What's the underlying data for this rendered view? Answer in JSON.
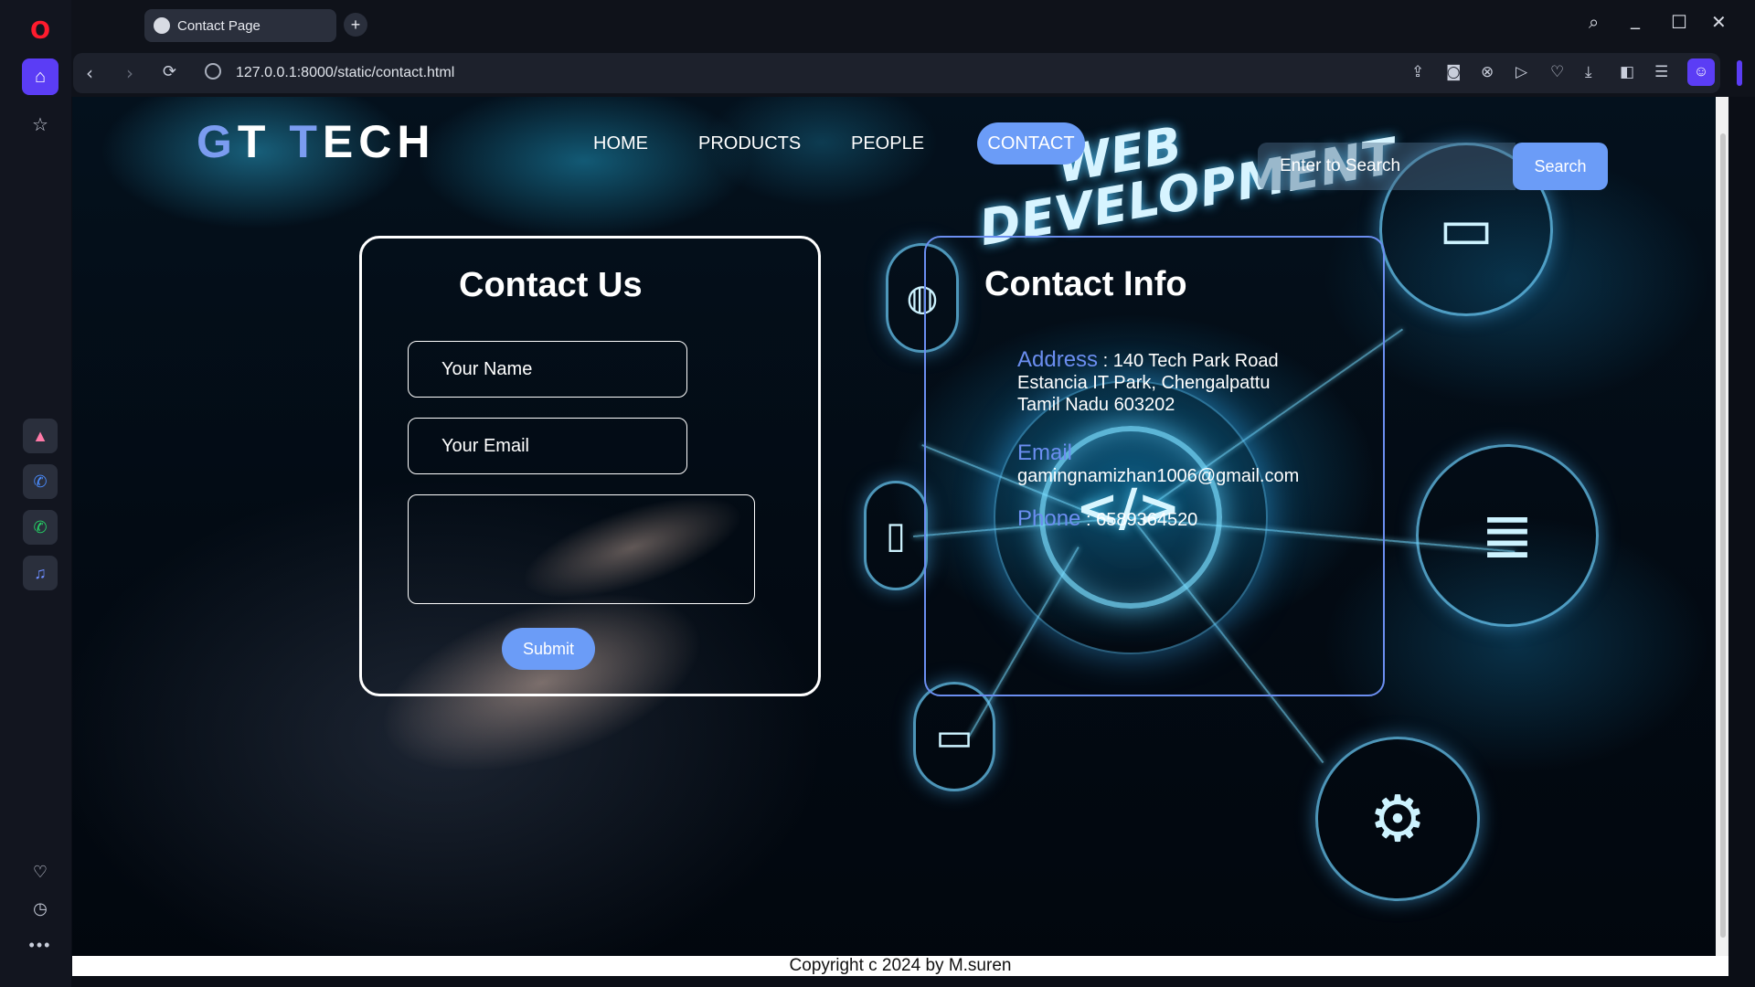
{
  "browser": {
    "tab_title": "Contact Page",
    "new_tab_icon": "+",
    "url": "127.0.0.1:8000/static/contact.html",
    "icons": {
      "opera": "O",
      "back": "‹",
      "forward": "›",
      "reload": "⟳",
      "search": "⌕",
      "minimize": "_",
      "maximize": "☐",
      "close": "✕"
    }
  },
  "page": {
    "logo_accent_1": "G",
    "logo_part_1": "T ",
    "logo_accent_2": "T",
    "logo_part_2": "ECH",
    "nav": {
      "home": "HOME",
      "products": "PRODUCTS",
      "people": "PEOPLE",
      "contact": "CONTACT"
    },
    "search_placeholder": "Enter to Search",
    "search_button": "Search",
    "hero_text_1": "WEB",
    "hero_text_2": "DEVELOPMENT",
    "hub_code": "</>"
  },
  "contact_form": {
    "title": "Contact Us",
    "name_placeholder": "Your Name",
    "email_placeholder": "Your Email",
    "message_value": "",
    "submit_label": "Submit"
  },
  "contact_info": {
    "title": "Contact Info",
    "address_label": "Address",
    "address_line_1": " : 140 Tech Park Road",
    "address_line_2": "Estancia IT Park, Chengalpattu",
    "address_line_3": "Tamil Nadu 603202",
    "email_label": "Email",
    "email_value": "gamingnamizhan1006@gmail.com",
    "phone_label": "Phone",
    "phone_sep": " : ",
    "phone_value": "6589364520"
  },
  "footer": {
    "copyright": "Copyright c 2024 by M.suren"
  },
  "colors": {
    "accent": "#6b9cf7",
    "label_blue": "#6b8ef0",
    "opera_red": "#ff1b2d",
    "opera_purple": "#5b3df5"
  }
}
